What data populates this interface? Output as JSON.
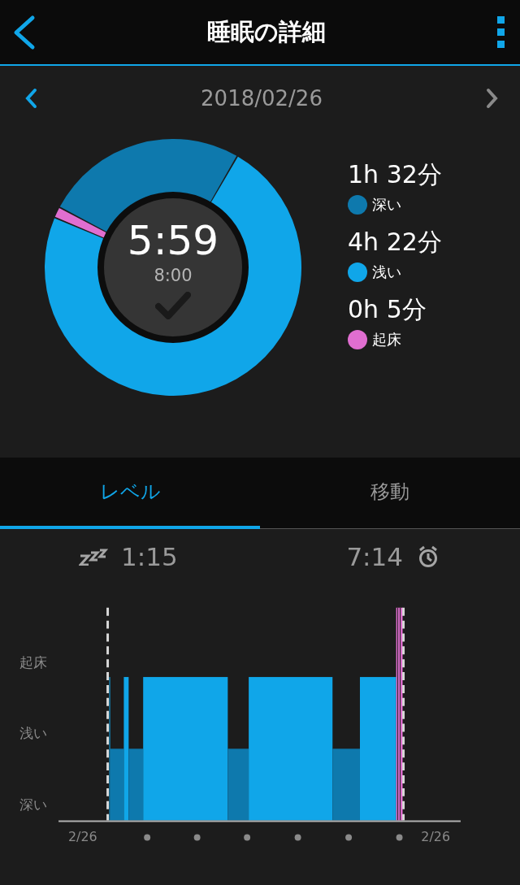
{
  "header": {
    "title": "睡眠の詳細"
  },
  "date_nav": {
    "date": "2018/02/26"
  },
  "summary": {
    "total": "5:59",
    "goal": "8:00",
    "goal_met": true,
    "chart_data": {
      "type": "donut",
      "categories": [
        "深い",
        "浅い",
        "起床"
      ],
      "values": [
        25.6,
        73.0,
        1.4
      ]
    },
    "legend": [
      {
        "duration": "1h 32分",
        "color": "#0e79ad"
      },
      {
        "duration": "4h 22分",
        "color": "#10a6e9"
      },
      {
        "duration": "0h 5分",
        "color": "#e06ed0"
      }
    ]
  },
  "tabs": [
    {
      "label": "レベル",
      "selected": true
    },
    {
      "label": "移動",
      "selected": false
    }
  ],
  "level_chart": {
    "sleep_start": "1:15",
    "wake_time": "7:14",
    "y_labels": [
      "起床",
      "浅い",
      "深い"
    ],
    "x_labels": [
      "2/26",
      "2/26"
    ]
  }
}
